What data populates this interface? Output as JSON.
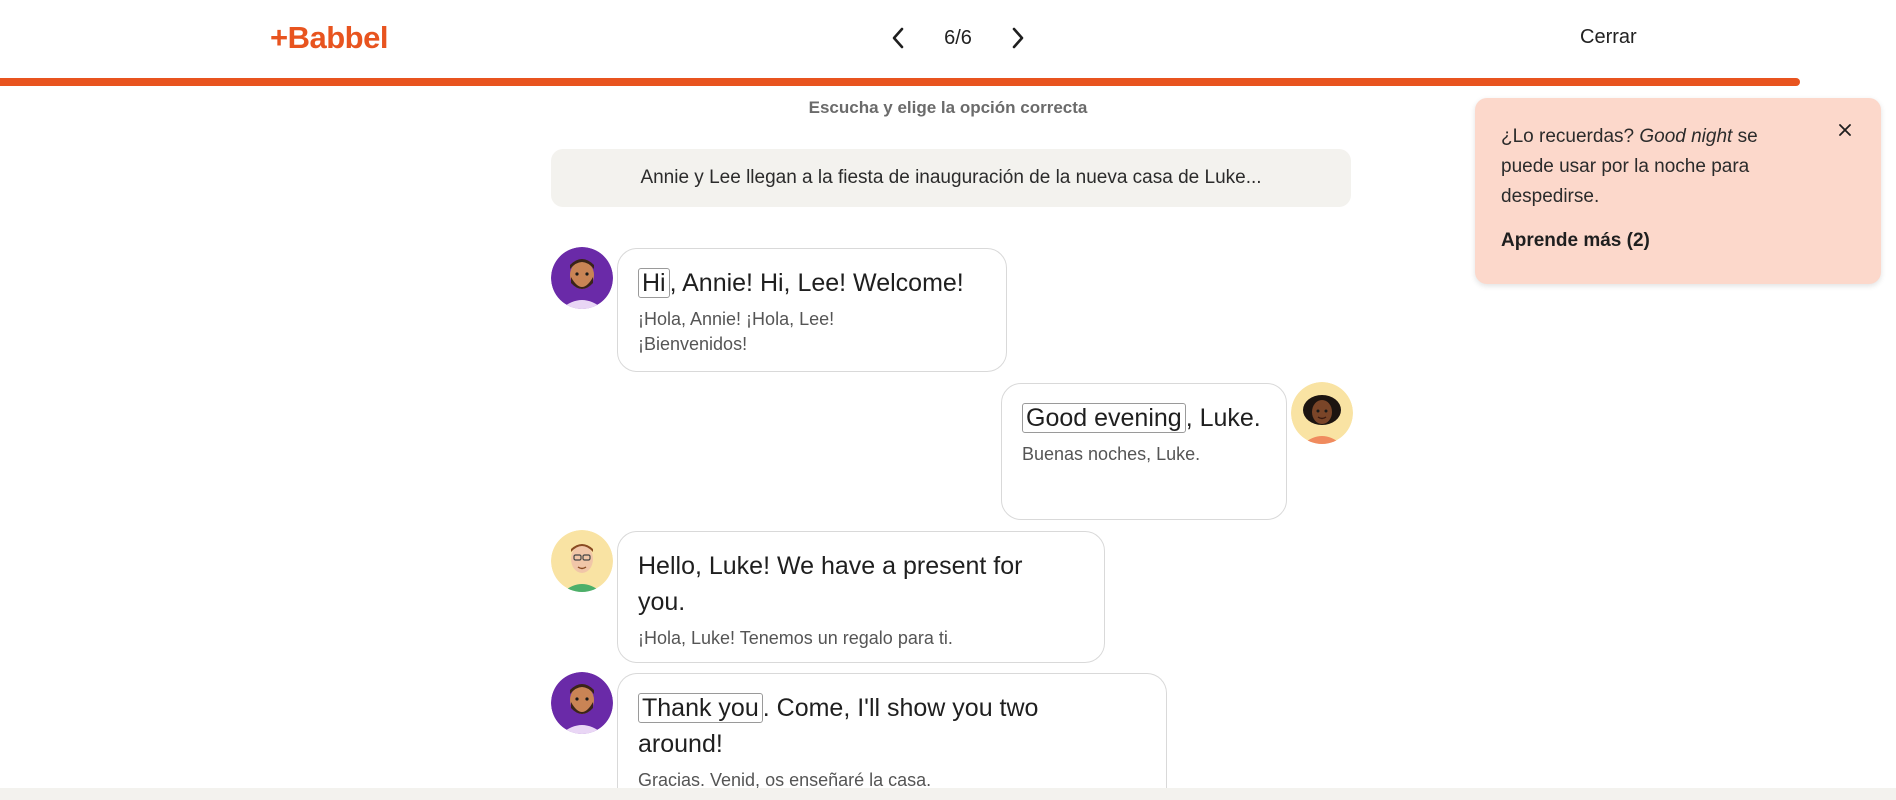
{
  "header": {
    "logo": "+Babbel",
    "pager": "6/6",
    "close_label": "Cerrar"
  },
  "progress": {
    "fraction": 1.0,
    "color": "#e8541f"
  },
  "instruction": "Escucha y elige la opción correcta",
  "context": "Annie y Lee llegan a la fiesta de inauguración de la nueva casa de Luke...",
  "dialog": [
    {
      "speaker_icon": "man-beard-avatar-icon",
      "side": "left",
      "keyword": "Hi",
      "en_rest": ", Annie! Hi, Lee! Welcome!",
      "es": "¡Hola, Annie! ¡Hola, Lee! ¡Bienvenidos!"
    },
    {
      "speaker_icon": "woman-avatar-icon",
      "side": "right",
      "keyword": "Good evening",
      "en_rest": ", Luke.",
      "es": "Buenas noches, Luke."
    },
    {
      "speaker_icon": "man-glasses-avatar-icon",
      "side": "left",
      "keyword": "",
      "en_rest": "Hello, Luke! We have a present for you.",
      "es": "¡Hola, Luke! Tenemos un regalo para ti."
    },
    {
      "speaker_icon": "man-beard-avatar-icon",
      "side": "left",
      "keyword": "Thank you",
      "en_rest": ". Come, I'll show you two around!",
      "es": "Gracias. Venid, os enseñaré la casa."
    }
  ],
  "tooltip": {
    "text_prefix": "¿Lo recuerdas? ",
    "text_em": "Good night",
    "text_suffix": " se puede usar por la noche para despedirse.",
    "link": "Aprende más (2)"
  },
  "colors": {
    "brand": "#e8541f",
    "tooltip_bg": "#fcd8cb",
    "context_bg": "#f3f2ee"
  }
}
